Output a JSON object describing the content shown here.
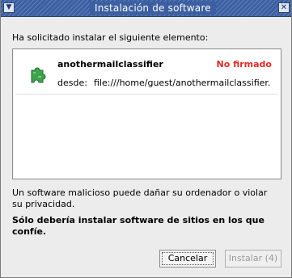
{
  "window": {
    "title": "Instalación de software"
  },
  "dialog": {
    "intro": "Ha solicitado instalar el siguiente elemento:",
    "item": {
      "name": "anothermailclassifier",
      "status": "No firmado",
      "from_label": "desde:",
      "from_url": "file:///home/guest/anothermailclassifier."
    },
    "warning": "Un software malicioso puede dañar su ordenador o violar su privacidad.",
    "warning_bold": "Sólo debería instalar software de sitios en los que confíe."
  },
  "buttons": {
    "cancel": "Cancelar",
    "install": "Instalar (4)"
  },
  "colors": {
    "unsigned": "#e12b26",
    "titlebar": "#3b5fa0"
  },
  "icons": {
    "window_menu": "chevron-down-icon",
    "close": "close-icon",
    "addon": "puzzle-piece-icon"
  }
}
